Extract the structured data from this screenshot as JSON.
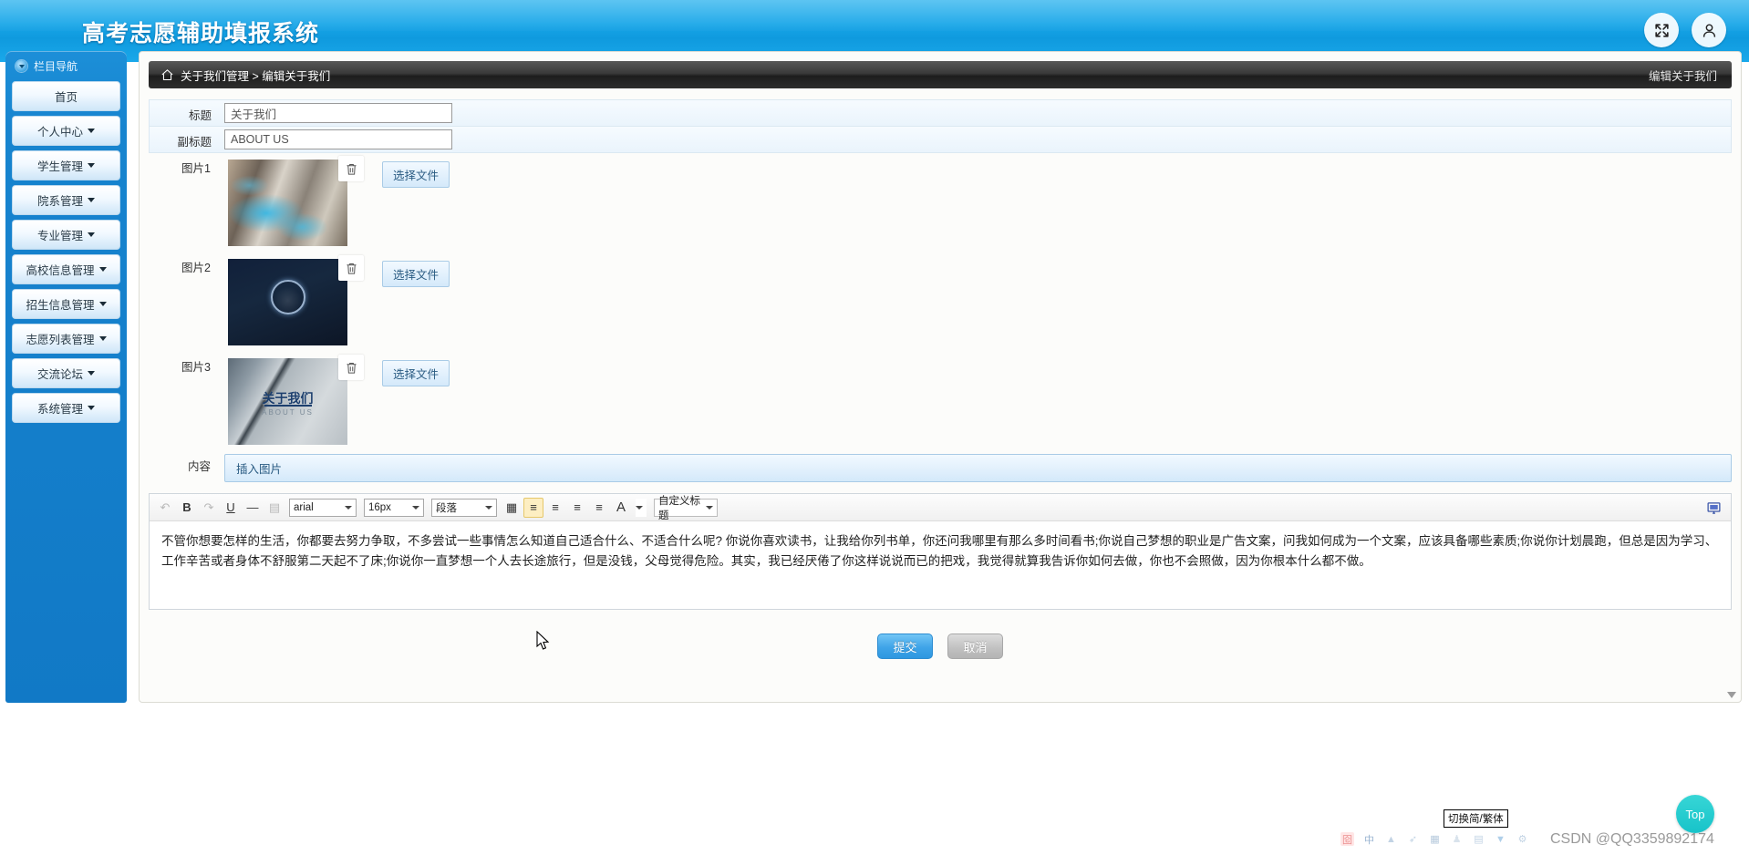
{
  "header": {
    "app_title": "高考志愿辅助填报系统",
    "icons": [
      {
        "name": "fullscreen-icon",
        "glyph": "fullscreen"
      },
      {
        "name": "user-icon",
        "glyph": "user"
      }
    ]
  },
  "sidebar": {
    "nav_title": "栏目导航",
    "items": [
      {
        "label": "首页",
        "has_caret": false
      },
      {
        "label": "个人中心",
        "has_caret": true
      },
      {
        "label": "学生管理",
        "has_caret": true
      },
      {
        "label": "院系管理",
        "has_caret": true
      },
      {
        "label": "专业管理",
        "has_caret": true
      },
      {
        "label": "高校信息管理",
        "has_caret": true
      },
      {
        "label": "招生信息管理",
        "has_caret": true
      },
      {
        "label": "志愿列表管理",
        "has_caret": true
      },
      {
        "label": "交流论坛",
        "has_caret": true
      },
      {
        "label": "系统管理",
        "has_caret": true
      }
    ]
  },
  "breadcrumb": {
    "home_icon": "home-icon",
    "path": "关于我们管理 > 编辑关于我们",
    "right_label": "编辑关于我们"
  },
  "form": {
    "title_label": "标题",
    "title_value": "关于我们",
    "title_placeholder": "关于我们",
    "subtitle_label": "副标题",
    "subtitle_value": "ABOUT US",
    "subtitle_placeholder": "ABOUT US",
    "images": [
      {
        "label": "图片1",
        "file_button": "选择文件",
        "delete_icon": "trash-icon",
        "alt": "city-map-network"
      },
      {
        "label": "图片2",
        "file_button": "选择文件",
        "delete_icon": "trash-icon",
        "alt": "hand-holding-lock"
      },
      {
        "label": "图片3",
        "file_button": "选择文件",
        "delete_icon": "trash-icon",
        "alt": "about-us-building",
        "overlay_cn": "关于我们",
        "overlay_en": "ABOUT US"
      }
    ],
    "content_label": "内容",
    "insert_image_button": "插入图片"
  },
  "editor": {
    "toolbar": {
      "undo": "↶",
      "bold": "B",
      "redo": "↷",
      "underline": "U",
      "hr": "—",
      "page": "▤",
      "font_family": "arial",
      "font_size": "16px",
      "paragraph": "段落",
      "table": "▦",
      "align_left": "≡",
      "align_right": "≡",
      "align_center": "≡",
      "align_justify": "≡",
      "text_color": "A",
      "custom_heading": "自定义标题",
      "fullscreen_icon": "monitor-icon"
    },
    "content": "不管你想要怎样的生活，你都要去努力争取，不多尝试一些事情怎么知道自己适合什么、不适合什么呢? 你说你喜欢读书，让我给你列书单，你还问我哪里有那么多时间看书;你说自己梦想的职业是广告文案，问我如何成为一个文案，应该具备哪些素质;你说你计划晨跑，但总是因为学习、工作辛苦或者身体不舒服第二天起不了床;你说你一直梦想一个人去长途旅行，但是没钱，父母觉得危险。其实，我已经厌倦了你这样说说而已的把戏，我觉得就算我告诉你如何去做，你也不会照做，因为你根本什么都不做。"
  },
  "actions": {
    "submit": "提交",
    "cancel": "取消"
  },
  "footer": {
    "ime_tooltip": "切换简/繁体",
    "watermark": "CSDN @QQ3359892174",
    "top_button": "Top"
  },
  "colors": {
    "brand_blue": "#18a6e8",
    "sidebar_blue": "#1784cf",
    "submit_blue": "#3fa4e8",
    "top_teal": "#17c3c9"
  }
}
